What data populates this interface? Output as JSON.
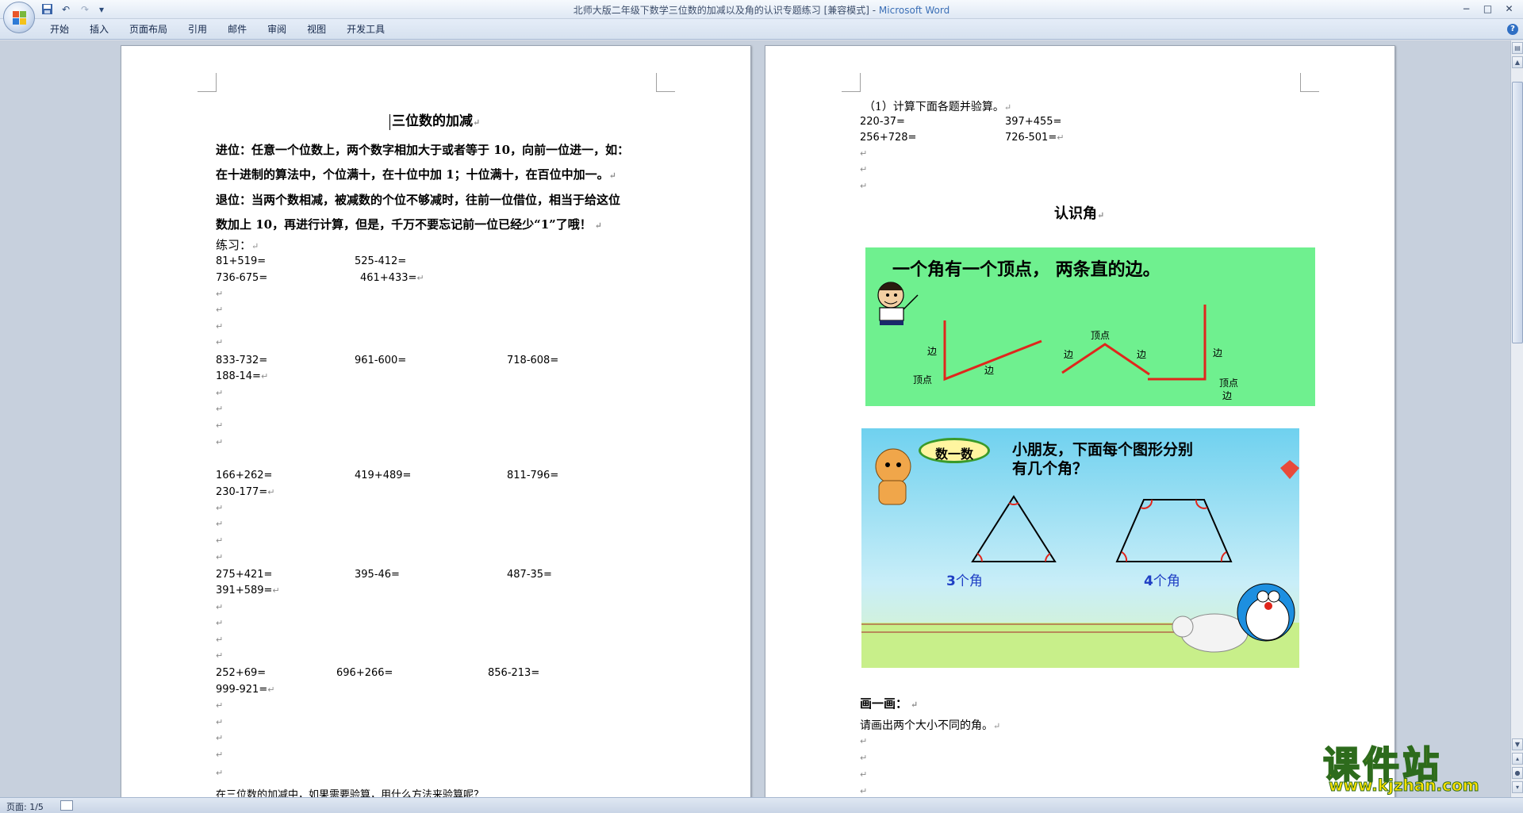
{
  "window": {
    "title": "北师大版二年级下数学三位数的加减以及角的认识专题练习 [兼容模式] - ",
    "app_name": "Microsoft Word",
    "min": "−",
    "max": "□",
    "close": "✕"
  },
  "qat": {
    "save": "save-icon",
    "undo": "↶",
    "redo": "↷",
    "customize": "▾"
  },
  "ribbon": {
    "tabs": [
      "开始",
      "插入",
      "页面布局",
      "引用",
      "邮件",
      "审阅",
      "视图",
      "开发工具"
    ]
  },
  "left_page": {
    "title": "三位数的加减",
    "para": [
      "进位：任意一个位数上，两个数字相加大于或者等于 10，向前一位进一，如：",
      "在十进制的算法中，个位满十，在十位中加 1；十位满十，在百位中加一。",
      "退位：当两个数相减，被减数的个位不够减时，往前一位借位，相当于给这位",
      "数加上 10，再进行计算，但是，千万不要忘记前一位已经少“1”了哦！"
    ],
    "practice_label": "练习：",
    "rows": [
      [
        "81+519=",
        "525-412="
      ],
      [
        "736-675=",
        "461+433="
      ],
      [
        "833-732=",
        "961-600=",
        "718-608="
      ],
      [
        "188-14="
      ],
      [
        "166+262=",
        "419+489=",
        "811-796="
      ],
      [
        "230-177="
      ],
      [
        "275+421=",
        "395-46=",
        "487-35="
      ],
      [
        "391+589="
      ],
      [
        "252+69=",
        "696+266=",
        "856-213="
      ],
      [
        "999-921="
      ]
    ],
    "bottom_text": "在三位数的加减中，如果需要验算，用什么方法来验算呢？"
  },
  "right_page": {
    "q1": "（1）计算下面各题并验算。",
    "q1_rows": [
      [
        "220-37=",
        "397+455="
      ],
      [
        "256+728=",
        "726-501="
      ]
    ],
    "section_title": "认识角",
    "fig1": {
      "heading": "一个角有一个顶点， 两条直的边。",
      "labels": {
        "side": "边",
        "vertex": "顶点"
      }
    },
    "fig2": {
      "badge": "数一数",
      "question_1": "小朋友，下面每个图形分别",
      "question_2": "有几个角？",
      "tri_n": "3",
      "tri_unit": "个角",
      "trap_n": "4",
      "trap_unit": "个角"
    },
    "draw_title": "画一画：",
    "draw_text": "请画出两个大小不同的角。"
  },
  "status": {
    "page": "页面: 1/5"
  },
  "watermark": {
    "big": "课件站",
    "url": "www.kjzhan.com"
  },
  "colors": {
    "angle_bg": "#6ff08f",
    "angle_line": "#e0261c",
    "sky": "#7fd6ef",
    "grass": "#c8ef8a"
  }
}
